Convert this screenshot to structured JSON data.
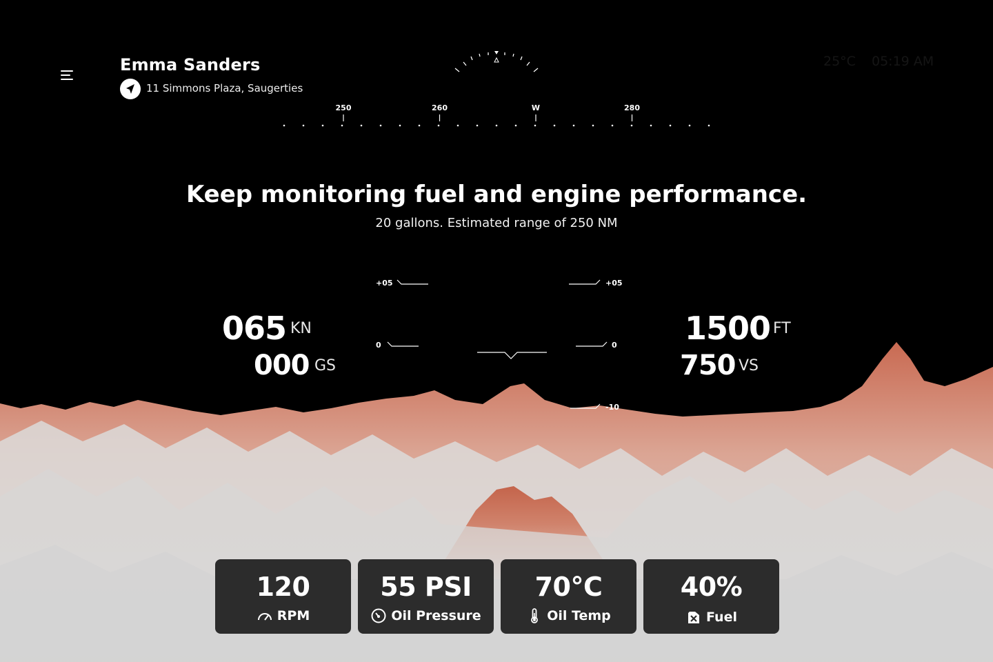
{
  "user": {
    "name": "Emma Sanders",
    "location": "11 Simmons Plaza, Saugerties"
  },
  "status": {
    "temperature": "25°C",
    "time": "05:19 AM"
  },
  "heading": {
    "labels": [
      {
        "text": "250",
        "value": 250
      },
      {
        "text": "260",
        "value": 260
      },
      {
        "text": "W",
        "value": 270
      },
      {
        "text": "280",
        "value": 280
      }
    ]
  },
  "message": {
    "title": "Keep monitoring fuel and engine performance.",
    "subtitle": "20 gallons. Estimated range of 250 NM"
  },
  "flight": {
    "airspeed_value": "065",
    "airspeed_unit": "KN",
    "groundspeed_value": "000",
    "groundspeed_unit": "GS",
    "altitude_value": "1500",
    "altitude_unit": "FT",
    "vertical_speed_value": "750",
    "vertical_speed_unit": "VS"
  },
  "pitch": {
    "left_labels": [
      "+05",
      "0"
    ],
    "right_labels": [
      "+05",
      "0",
      "-10"
    ]
  },
  "engine": [
    {
      "value": "120",
      "label": "RPM",
      "icon": "tachometer-icon"
    },
    {
      "value": "55 PSI",
      "label": "Oil Pressure",
      "icon": "oil-pressure-icon"
    },
    {
      "value": "70°C",
      "label": "Oil Temp",
      "icon": "thermometer-icon"
    },
    {
      "value": "40%",
      "label": "Fuel",
      "icon": "fuel-can-icon"
    }
  ],
  "colors": {
    "background": "#000000",
    "terrain_light": "#d8d8d8",
    "terrain_accent": "#c96a52",
    "card": "#2c2c2c"
  }
}
